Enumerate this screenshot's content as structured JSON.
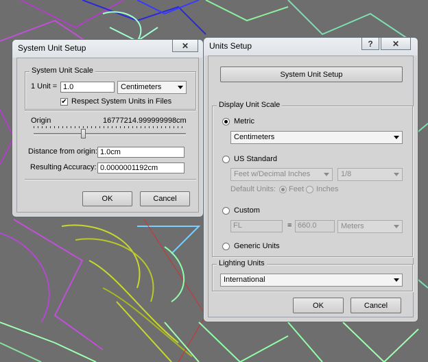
{
  "system_dialog": {
    "title": "System Unit Setup",
    "close_glyph": "✕",
    "group_label": "System Unit Scale",
    "unit_label": "1 Unit =",
    "unit_value": "1.0",
    "unit_type": "Centimeters",
    "respect_units_label": "Respect System Units in Files",
    "respect_units_checked": true,
    "origin_label": "Origin",
    "origin_value": "16777214.999999998cm",
    "distance_label": "Distance from origin:",
    "distance_value": "1.0cm",
    "accuracy_label": "Resulting Accuracy:",
    "accuracy_value": "0.0000001192cm",
    "ok_label": "OK",
    "cancel_label": "Cancel"
  },
  "units_dialog": {
    "title": "Units Setup",
    "help_glyph": "?",
    "close_glyph": "✕",
    "system_unit_button": "System Unit Setup",
    "display_group_label": "Display Unit Scale",
    "metric_label": "Metric",
    "metric_selected": true,
    "metric_value": "Centimeters",
    "us_label": "US Standard",
    "us_value": "Feet w/Decimal Inches",
    "us_fraction": "1/8",
    "default_units_label": "Default Units:",
    "feet_label": "Feet",
    "inches_label": "Inches",
    "custom_label": "Custom",
    "custom_name": "FL",
    "equals": "=",
    "custom_amount": "660.0",
    "custom_unit": "Meters",
    "generic_label": "Generic Units",
    "lighting_group_label": "Lighting Units",
    "lighting_value": "International",
    "ok_label": "OK",
    "cancel_label": "Cancel"
  }
}
